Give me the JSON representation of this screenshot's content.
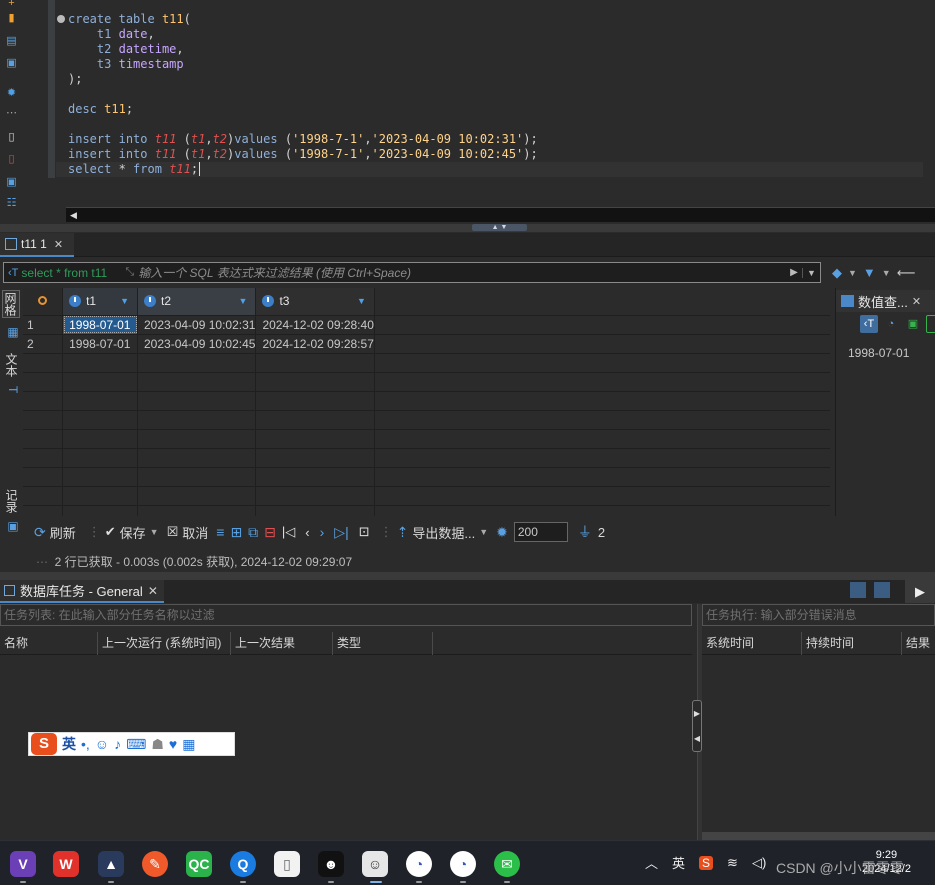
{
  "editor": {
    "lines": [
      {
        "parts": [
          [
            "kw",
            "create"
          ],
          [
            "",
            " "
          ],
          [
            "kw",
            "table"
          ],
          [
            "",
            " "
          ],
          [
            "id",
            "t11"
          ],
          [
            "",
            "("
          ]
        ]
      },
      {
        "parts": [
          [
            "",
            "    "
          ],
          [
            "col2",
            "t1"
          ],
          [
            "",
            " "
          ],
          [
            "ty",
            "date"
          ],
          [
            "",
            ","
          ]
        ]
      },
      {
        "parts": [
          [
            "",
            "    "
          ],
          [
            "col2",
            "t2"
          ],
          [
            "",
            " "
          ],
          [
            "ty",
            "datetime"
          ],
          [
            "",
            ","
          ]
        ]
      },
      {
        "parts": [
          [
            "",
            "    "
          ],
          [
            "col2",
            "t3"
          ],
          [
            "",
            " "
          ],
          [
            "ty",
            "timestamp"
          ]
        ]
      },
      {
        "parts": [
          [
            "",
            ");"
          ]
        ]
      },
      {
        "parts": [
          [
            "",
            ""
          ]
        ]
      },
      {
        "parts": [
          [
            "kw",
            "desc"
          ],
          [
            "",
            " "
          ],
          [
            "id",
            "t11"
          ],
          [
            "",
            ";"
          ]
        ]
      },
      {
        "parts": [
          [
            "",
            ""
          ]
        ]
      },
      {
        "parts": [
          [
            "kw",
            "insert"
          ],
          [
            "",
            " "
          ],
          [
            "kw",
            "into"
          ],
          [
            "",
            " "
          ],
          [
            "tb",
            "t11"
          ],
          [
            "",
            " ("
          ],
          [
            "col",
            "t1"
          ],
          [
            "",
            ","
          ],
          [
            "col",
            "t2"
          ],
          [
            "",
            ")"
          ],
          [
            "kw",
            "values"
          ],
          [
            "",
            " ("
          ],
          [
            "str",
            "'1998-7-1'"
          ],
          [
            "",
            ","
          ],
          [
            "str",
            "'2023-04-09 10:02:31'"
          ],
          [
            "",
            ");"
          ]
        ]
      },
      {
        "parts": [
          [
            "kw",
            "insert"
          ],
          [
            "",
            " "
          ],
          [
            "kw",
            "into"
          ],
          [
            "",
            " "
          ],
          [
            "tb",
            "t11"
          ],
          [
            "",
            " ("
          ],
          [
            "col",
            "t1"
          ],
          [
            "",
            ","
          ],
          [
            "col",
            "t2"
          ],
          [
            "",
            ")"
          ],
          [
            "kw",
            "values"
          ],
          [
            "",
            " ("
          ],
          [
            "str",
            "'1998-7-1'"
          ],
          [
            "",
            ","
          ],
          [
            "str",
            "'2023-04-09 10:02:45'"
          ],
          [
            "",
            ");"
          ]
        ]
      },
      {
        "parts": [
          [
            "kw",
            "select"
          ],
          [
            "",
            " * "
          ],
          [
            "kw",
            "from"
          ],
          [
            "",
            " "
          ],
          [
            "tb",
            "t11"
          ],
          [
            "",
            ";"
          ]
        ],
        "current": true
      }
    ]
  },
  "result_tab": {
    "label": "t11 1"
  },
  "filter": {
    "sql": "select * from t11",
    "placeholder": "输入一个 SQL 表达式来过滤结果 (使用 Ctrl+Space)"
  },
  "side_tabs": [
    "网格",
    "文本",
    "记录"
  ],
  "grid": {
    "columns": [
      "t1",
      "t2",
      "t3"
    ],
    "rows": [
      {
        "num": "1",
        "cells": [
          "1998-07-01",
          "2023-04-09 10:02:31",
          "2024-12-02 09:28:40"
        ]
      },
      {
        "num": "2",
        "cells": [
          "1998-07-01",
          "2023-04-09 10:02:45",
          "2024-12-02 09:28:57"
        ]
      }
    ],
    "empty_rows": 9
  },
  "value_panel": {
    "title": "数值查...",
    "value": "1998-07-01"
  },
  "toolbar": {
    "refresh": "刷新",
    "save": "保存",
    "cancel": "取消",
    "export": "导出数据...",
    "limit": "200",
    "count": "2"
  },
  "status": {
    "text": "2 行已获取 - 0.003s (0.002s 获取), 2024-12-02 09:29:07"
  },
  "tasks": {
    "tab_label": "数据库任务 - General",
    "filter_placeholder": "任务列表: 在此输入部分任务名称以过滤",
    "exec_placeholder": "任务执行: 输入部分错误消息",
    "columns": [
      {
        "label": "名称"
      },
      {
        "label": "上一次运行 (系统时间)"
      },
      {
        "label": "上一次结果"
      },
      {
        "label": "类型"
      },
      {
        "label": ""
      }
    ],
    "exec_columns": [
      {
        "label": "系统时间"
      },
      {
        "label": "持续时间"
      },
      {
        "label": "结果"
      }
    ]
  },
  "ime": {
    "lang": "英"
  },
  "taskbar": {
    "tray_lang": "英",
    "time": "9:29",
    "date": "2024/12/2"
  },
  "watermark": "CSDN @小小雷零零"
}
